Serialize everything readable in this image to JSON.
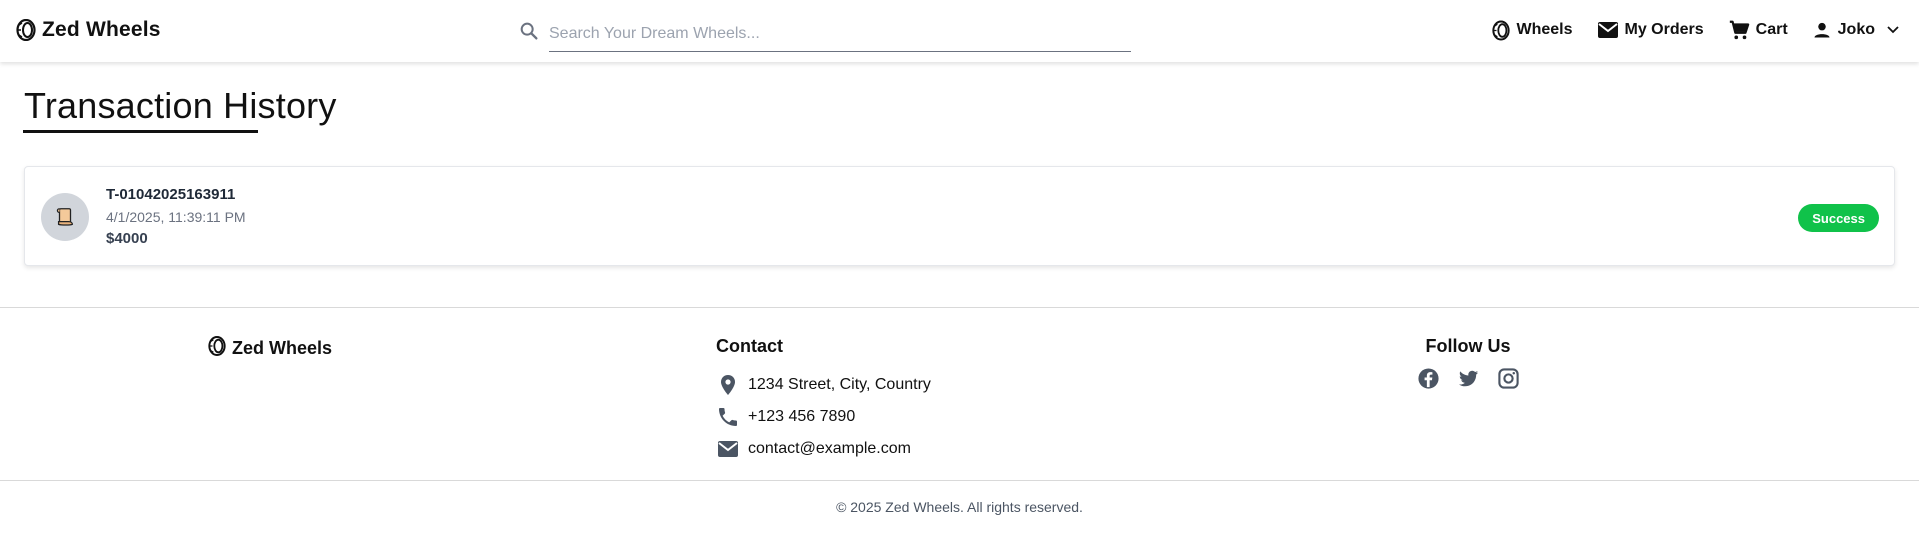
{
  "header": {
    "brand": "Zed Wheels",
    "search_placeholder": "Search Your Dream Wheels...",
    "nav": {
      "wheels": "Wheels",
      "orders": "My Orders",
      "cart": "Cart",
      "user": "Joko"
    }
  },
  "main": {
    "title": "Transaction History",
    "transactions": [
      {
        "id": "T-01042025163911",
        "datetime": "4/1/2025, 11:39:11 PM",
        "amount": "$4000",
        "status": "Success"
      }
    ]
  },
  "footer": {
    "brand": "Zed Wheels",
    "contact_heading": "Contact",
    "address": "1234 Street, City, Country",
    "phone": "+123 456 7890",
    "email": "contact@example.com",
    "follow_heading": "Follow Us",
    "social_icons": [
      "facebook-icon",
      "twitter-icon",
      "instagram-icon"
    ],
    "copyright": "© 2025 Zed Wheels. All rights reserved."
  },
  "colors": {
    "success": "#10c24a",
    "icon_gray": "#4b5563"
  }
}
